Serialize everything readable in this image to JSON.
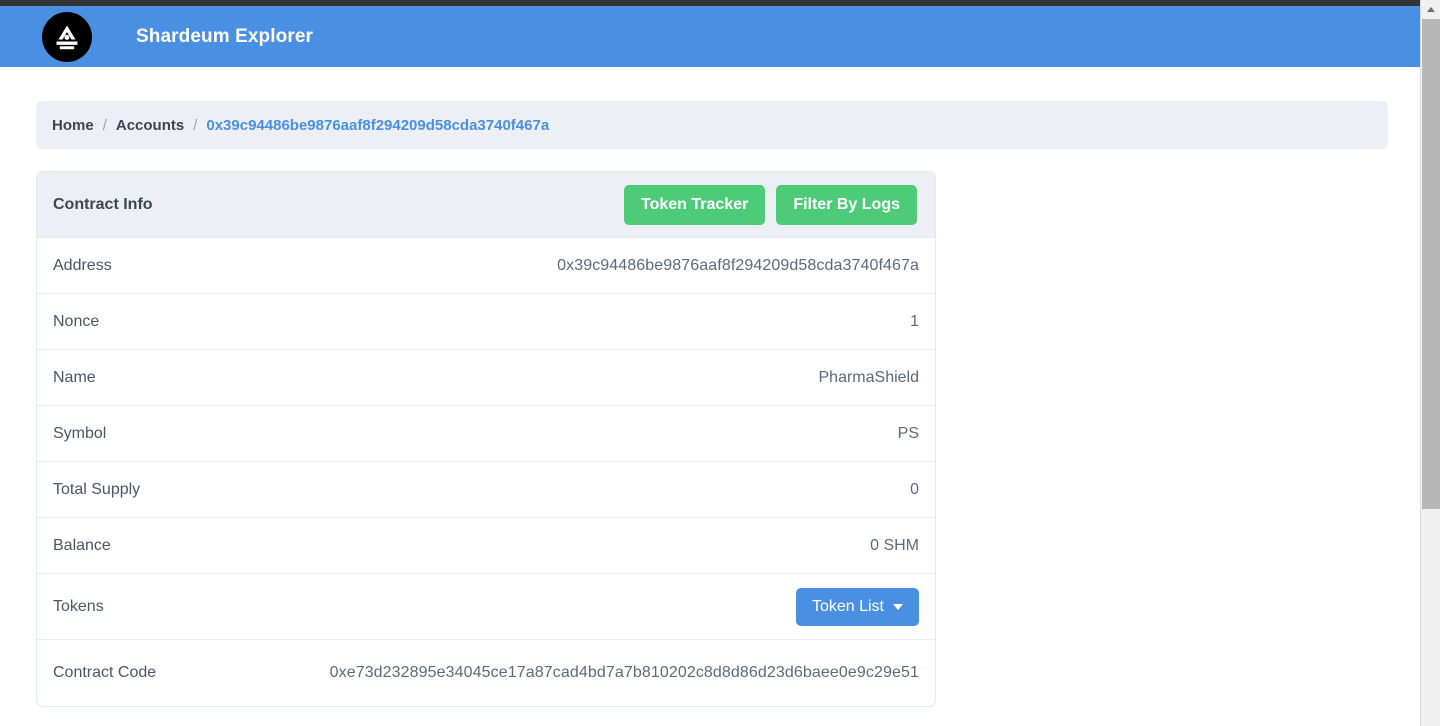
{
  "navbar": {
    "brand_title": "Shardeum Explorer",
    "logo_icon": "shardeum-logo-icon",
    "background_color": "#4a90e2"
  },
  "breadcrumb": {
    "items": [
      {
        "label": "Home",
        "current": false
      },
      {
        "label": "Accounts",
        "current": false
      },
      {
        "label": "0x39c94486be9876aaf8f294209d58cda3740f467a",
        "current": true
      }
    ],
    "separator": "/",
    "link_color": "#4a90e2",
    "background_color": "#eceff4"
  },
  "card": {
    "title": "Contract Info",
    "actions": [
      {
        "label": "Token Tracker",
        "color": "#4ecb79"
      },
      {
        "label": "Filter By Logs",
        "color": "#4ecb79"
      }
    ],
    "rows": [
      {
        "label": "Address",
        "value": "0x39c94486be9876aaf8f294209d58cda3740f467a"
      },
      {
        "label": "Nonce",
        "value": "1"
      },
      {
        "label": "Name",
        "value": "PharmaShield"
      },
      {
        "label": "Symbol",
        "value": "PS"
      },
      {
        "label": "Total Supply",
        "value": "0"
      },
      {
        "label": "Balance",
        "value": "0 SHM"
      }
    ],
    "tokens_row": {
      "label": "Tokens",
      "button_label": "Token List",
      "button_caret": "chevron-down-icon",
      "button_color": "#4a90e2"
    },
    "code_row": {
      "label": "Contract Code",
      "value": "0xe73d232895e34045ce17a87cad4bd7a7b810202c8d8d86d23d6baee0e9c29e51"
    }
  },
  "scrollbar": {
    "up_arrow_icon": "caret-up-icon",
    "thumb_color": "#b8b8b8"
  }
}
